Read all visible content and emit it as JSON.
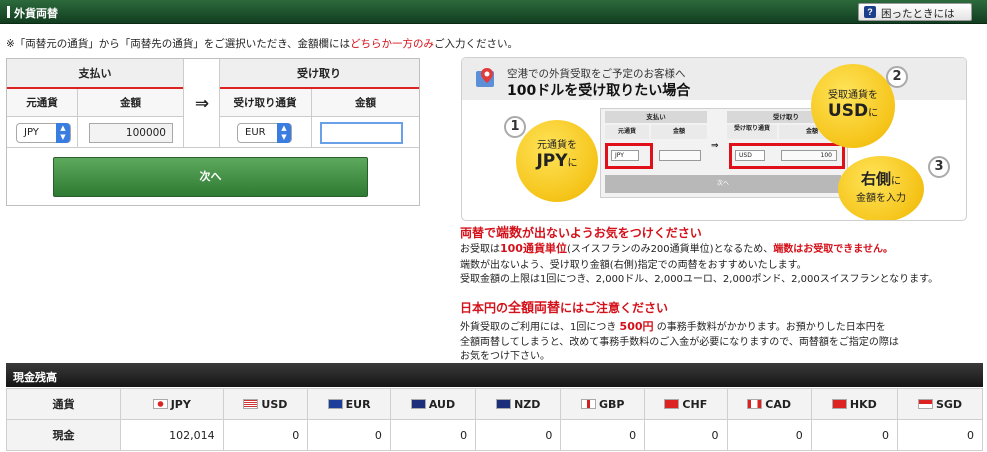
{
  "titlebar": {
    "title": "外貨両替",
    "help_label": "困ったときには",
    "help_icon": "?"
  },
  "notice": {
    "prefix": "※「両替元の通貨」から「両替先の通貨」をご選択いただき、金額欄には",
    "highlight": "どちらか一方のみ",
    "suffix": "ご入力ください。"
  },
  "form": {
    "pay_header": "支払い",
    "receive_header": "受け取り",
    "source_currency_label": "元通貨",
    "amount_label": "金額",
    "receive_currency_label": "受け取り通貨",
    "receive_amount_label": "金額",
    "arrow": "⇒",
    "source_currency": "JPY",
    "source_amount": "100000",
    "receive_currency": "EUR",
    "receive_amount": "",
    "next_label": "次へ"
  },
  "guide": {
    "line1": "空港での外貨受取をご予定のお客様へ",
    "line2": "100ドルを受け取りたい場合",
    "mini_pay": "支払い",
    "mini_receive": "受け取り",
    "mini_src": "元通貨",
    "mini_amt": "金額",
    "mini_rcv_cur": "受け取り通貨",
    "mini_rcv_amt": "金額",
    "mini_arrow": "⇒",
    "mini_jpy": "JPY",
    "mini_usd": "USD",
    "mini_100": "100",
    "mini_next": "次へ",
    "step1_num": "1",
    "step1_a": "元通貨を",
    "step1_b": "JPY",
    "step1_c": "に",
    "step2_num": "2",
    "step2_a": "受取通貨を",
    "step2_b": "USD",
    "step2_c": "に",
    "step3_num": "3",
    "step3_a": "右側",
    "step3_b": "に",
    "step3_c": "金額を入力"
  },
  "warnings": {
    "w1_a": "両替で",
    "w1_b": "端数",
    "w1_c": "が出ないようお気をつけください",
    "p1_a": "お受取は",
    "p1_b": "100通貨単位",
    "p1_c": "(スイスフランのみ200通貨単位)となるため、",
    "p1_d": "端数はお受取できません。",
    "p2": "端数が出ないよう、受け取り金額(右側)指定での両替をおすすめいたします。",
    "p3": "受取金額の上限は1回につき、2,000ドル、2,000ユーロ、2,000ポンド、2,000スイスフランとなります。",
    "w2_a": "日本円の",
    "w2_b": "全額両替",
    "w2_c": "にはご注意ください",
    "p4_a": "外貨受取のご利用には、1回につき ",
    "p4_b": "500円",
    "p4_c": " の事務手数料がかかります。お預かりした日本円を",
    "p5": "全額両替してしまうと、改めて事務手数料のご入金が必要になりますので、両替額をご指定の際は",
    "p6": "お気をつけ下さい。"
  },
  "balance": {
    "title": "現金残高",
    "currency_header": "通貨",
    "cash_label": "現金",
    "currencies": [
      "JPY",
      "USD",
      "EUR",
      "AUD",
      "NZD",
      "GBP",
      "CHF",
      "CAD",
      "HKD",
      "SGD"
    ],
    "values": [
      "102,014",
      "0",
      "0",
      "0",
      "0",
      "0",
      "0",
      "0",
      "0",
      "0"
    ]
  },
  "colors": {
    "header_green": "#1e5430",
    "alert_red": "#d4111a",
    "next_green": "#3f8a40",
    "accent_yellow": "#f5c419"
  }
}
